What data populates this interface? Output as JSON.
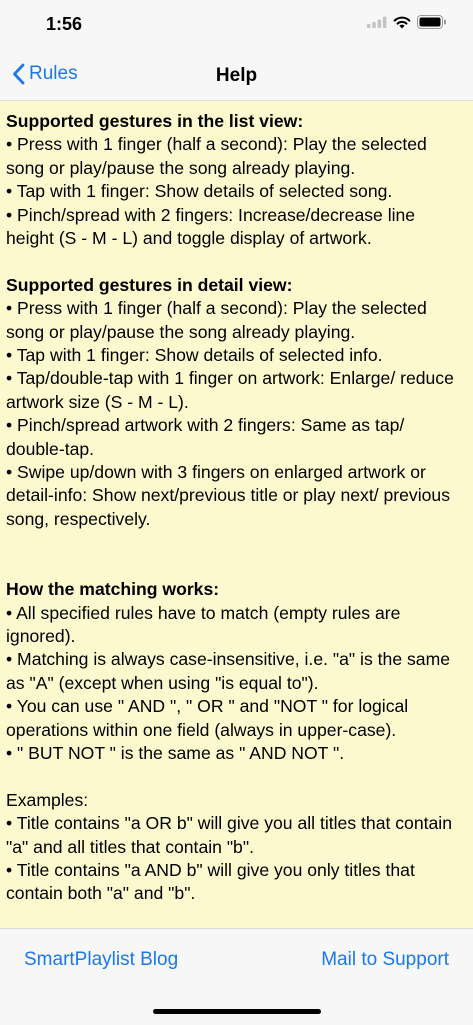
{
  "status": {
    "time": "1:56"
  },
  "nav": {
    "back_label": "Rules",
    "title": "Help"
  },
  "help": {
    "list_title": "Supported gestures in the list view:",
    "list_items": [
      "• Press with 1 finger (half a second): Play the selected song or play/pause the song already playing.",
      "• Tap with 1 finger: Show  details of selected song.",
      "• Pinch/spread with 2 fingers: Increase/decrease line height (S - M - L) and toggle display of artwork."
    ],
    "detail_title": "Supported gestures in detail view:",
    "detail_items": [
      "• Press with 1 finger (half a second): Play the selected song or play/pause the song already playing.",
      "• Tap with 1 finger: Show details of selected info.",
      "• Tap/double-tap with 1 finger on artwork: Enlarge/ reduce artwork size (S - M - L).",
      "• Pinch/spread artwork with 2 fingers: Same as tap/ double-tap.",
      "• Swipe up/down with 3 fingers on enlarged artwork or detail-info: Show next/previous title or play next/ previous song, respectively."
    ],
    "matching_title": "How the matching works:",
    "matching_items": [
      "• All specified rules have to match (empty rules are ignored).",
      "• Matching is always case-insensitive, i.e. \"a\" is the same as \"A\" (except when using \"is equal to\").",
      "• You can use \" AND \", \" OR \" and \"NOT \" for logical operations within one field (always in upper-case).",
      "• \" BUT NOT \" is the same as \" AND NOT \"."
    ],
    "examples_title": "Examples:",
    "examples_items": [
      "• Title contains \"a OR b\" will give you all titles that contain \"a\" and all titles that contain \"b\".",
      "• Title contains \"a AND b\" will give you only titles that contain both \"a\" and \"b\"."
    ]
  },
  "bottom": {
    "blog_label": "SmartPlaylist Blog",
    "mail_label": "Mail to Support"
  }
}
